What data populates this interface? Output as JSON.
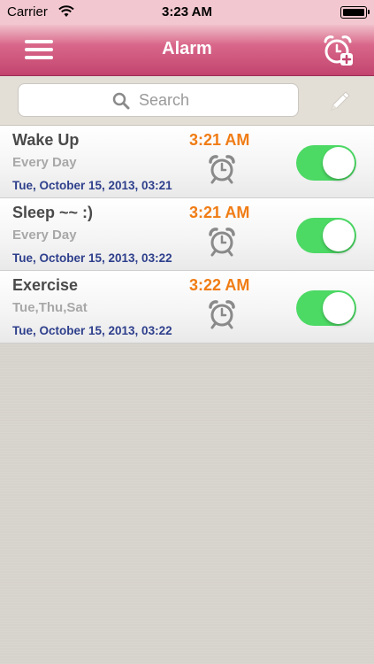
{
  "status_bar": {
    "carrier": "Carrier",
    "time": "3:23 AM"
  },
  "nav": {
    "title": "Alarm",
    "menu_icon": "hamburger-menu-icon",
    "add_icon": "add-alarm-clock-icon"
  },
  "search": {
    "placeholder": "Search",
    "icon": "search-icon",
    "edit_icon": "pencil-icon"
  },
  "alarms": [
    {
      "name": "Wake Up",
      "repeat": "Every Day",
      "date": "Tue, October 15, 2013, 03:21",
      "time": "3:21 AM",
      "enabled": true
    },
    {
      "name": "Sleep ~~ :)",
      "repeat": "Every Day",
      "date": "Tue, October 15, 2013, 03:22",
      "time": "3:21 AM",
      "enabled": true
    },
    {
      "name": "Exercise",
      "repeat": "Tue,Thu,Sat",
      "date": "Tue, October 15, 2013, 03:22",
      "time": "3:22 AM",
      "enabled": true
    }
  ],
  "colors": {
    "nav_accent": "#c2456f",
    "time_text": "#f07c14",
    "date_text": "#2e3f8c",
    "toggle_on": "#4cd964"
  }
}
